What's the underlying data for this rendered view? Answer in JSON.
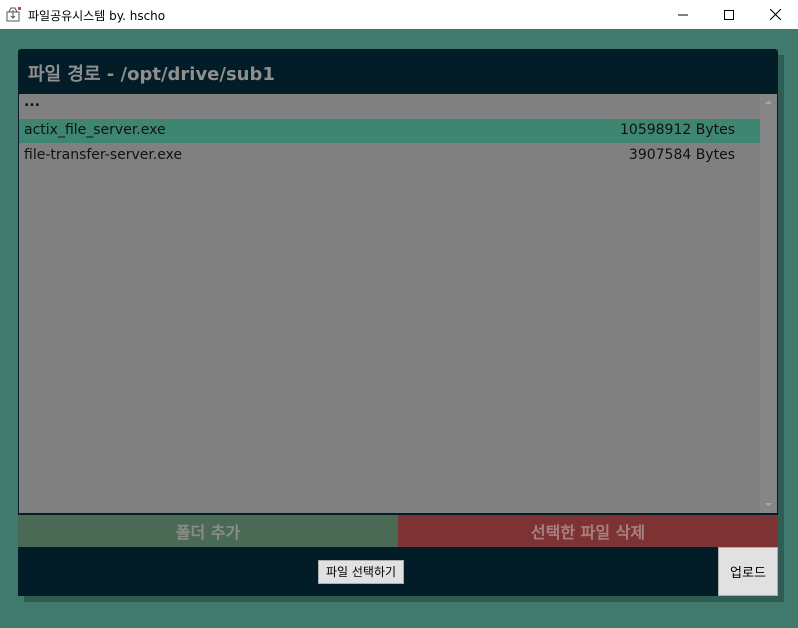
{
  "window": {
    "title": "파일공유시스템 by. hscho",
    "icons": {
      "app": "folder-share-icon",
      "minimize": "minimize-icon",
      "maximize": "maximize-icon",
      "close": "close-icon"
    }
  },
  "header": {
    "path_title": "파일 경로 - /opt/drive/sub1"
  },
  "file_list": {
    "parent": "...",
    "items": [
      {
        "name": "actix_file_server.exe",
        "size": "10598912 Bytes",
        "selected": true
      },
      {
        "name": "file-transfer-server.exe",
        "size": "3907584 Bytes",
        "selected": false
      }
    ]
  },
  "actions": {
    "add_folder": "폴더 추가",
    "delete_selected": "선택한 파일 삭제"
  },
  "footer": {
    "choose_file": "파일 선택하기",
    "upload": "업로드"
  },
  "colors": {
    "background": "#417a6d",
    "panel": "#021d28",
    "list_bg": "#808080",
    "selected_row": "#3e8672",
    "add_folder_bg": "#4a6a55",
    "delete_bg": "#7d3333"
  }
}
